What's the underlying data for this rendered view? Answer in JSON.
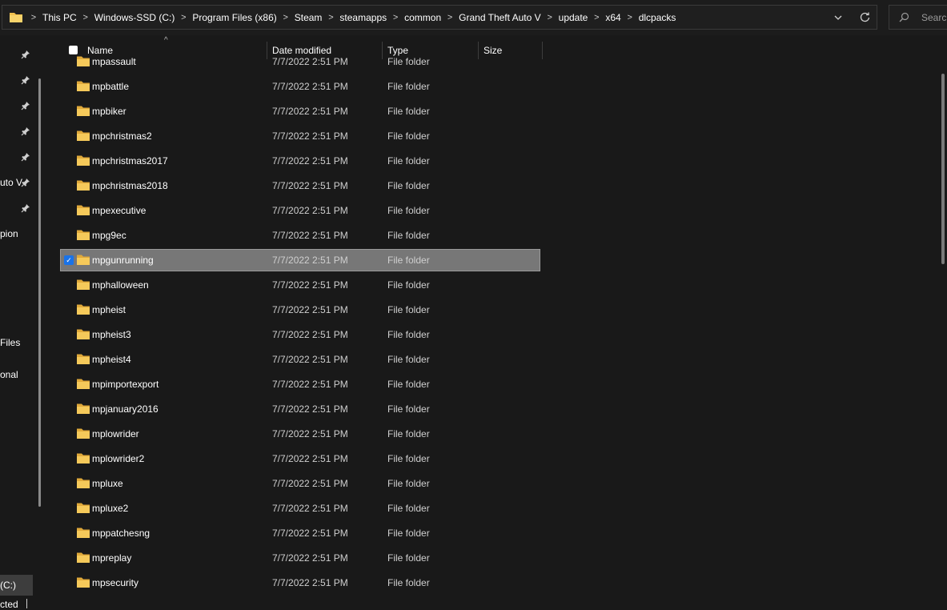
{
  "address": {
    "crumbs": [
      "This PC",
      "Windows-SSD (C:)",
      "Program Files (x86)",
      "Steam",
      "steamapps",
      "common",
      "Grand Theft Auto V",
      "update",
      "x64",
      "dlcpacks"
    ],
    "separator": ">",
    "dropdown_icon": "chevron-down-icon",
    "refresh_icon": "refresh-icon"
  },
  "search": {
    "placeholder": "Search"
  },
  "nav": {
    "labels": [
      "uto V",
      "pion",
      "Files",
      "onal"
    ],
    "drive_label": "(C:)"
  },
  "columns": {
    "name": "Name",
    "date": "Date modified",
    "type": "Type",
    "size": "Size"
  },
  "rows": [
    {
      "name": "mpassault",
      "date": "7/7/2022 2:51 PM",
      "type": "File folder"
    },
    {
      "name": "mpbattle",
      "date": "7/7/2022 2:51 PM",
      "type": "File folder"
    },
    {
      "name": "mpbiker",
      "date": "7/7/2022 2:51 PM",
      "type": "File folder"
    },
    {
      "name": "mpchristmas2",
      "date": "7/7/2022 2:51 PM",
      "type": "File folder"
    },
    {
      "name": "mpchristmas2017",
      "date": "7/7/2022 2:51 PM",
      "type": "File folder"
    },
    {
      "name": "mpchristmas2018",
      "date": "7/7/2022 2:51 PM",
      "type": "File folder"
    },
    {
      "name": "mpexecutive",
      "date": "7/7/2022 2:51 PM",
      "type": "File folder"
    },
    {
      "name": "mpg9ec",
      "date": "7/7/2022 2:51 PM",
      "type": "File folder"
    },
    {
      "name": "mpgunrunning",
      "date": "7/7/2022 2:51 PM",
      "type": "File folder",
      "selected": true
    },
    {
      "name": "mphalloween",
      "date": "7/7/2022 2:51 PM",
      "type": "File folder"
    },
    {
      "name": "mpheist",
      "date": "7/7/2022 2:51 PM",
      "type": "File folder"
    },
    {
      "name": "mpheist3",
      "date": "7/7/2022 2:51 PM",
      "type": "File folder"
    },
    {
      "name": "mpheist4",
      "date": "7/7/2022 2:51 PM",
      "type": "File folder"
    },
    {
      "name": "mpimportexport",
      "date": "7/7/2022 2:51 PM",
      "type": "File folder"
    },
    {
      "name": "mpjanuary2016",
      "date": "7/7/2022 2:51 PM",
      "type": "File folder"
    },
    {
      "name": "mplowrider",
      "date": "7/7/2022 2:51 PM",
      "type": "File folder"
    },
    {
      "name": "mplowrider2",
      "date": "7/7/2022 2:51 PM",
      "type": "File folder"
    },
    {
      "name": "mpluxe",
      "date": "7/7/2022 2:51 PM",
      "type": "File folder"
    },
    {
      "name": "mpluxe2",
      "date": "7/7/2022 2:51 PM",
      "type": "File folder"
    },
    {
      "name": "mppatchesng",
      "date": "7/7/2022 2:51 PM",
      "type": "File folder"
    },
    {
      "name": "mpreplay",
      "date": "7/7/2022 2:51 PM",
      "type": "File folder"
    },
    {
      "name": "mpsecurity",
      "date": "7/7/2022 2:51 PM",
      "type": "File folder"
    }
  ],
  "status": {
    "text": "cted"
  },
  "colors": {
    "folder": "#f2c14e",
    "selection": "#777777",
    "checkbox": "#1a73e8",
    "background": "#191919"
  }
}
